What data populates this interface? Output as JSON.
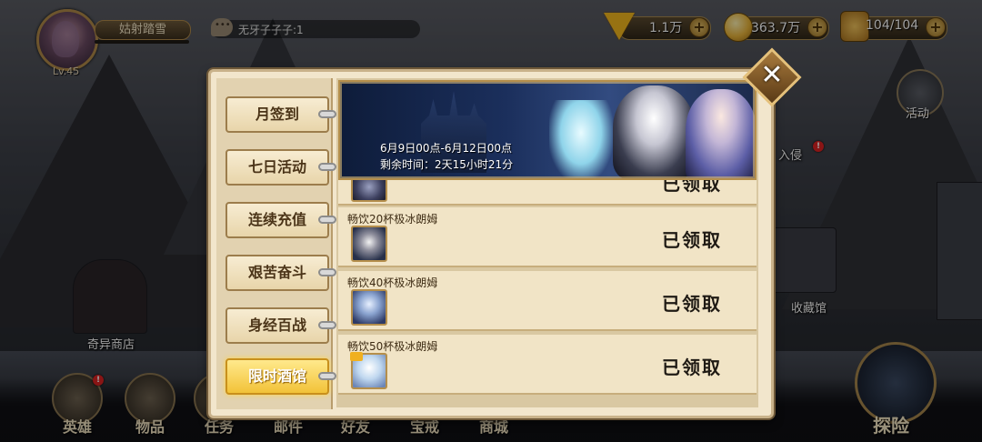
{
  "player": {
    "level": "Lv.45",
    "name": "姑射踏雪"
  },
  "chat": {
    "text": "无牙子子子:1"
  },
  "resources": [
    {
      "icon": "diamond-icon",
      "value": "1.1万"
    },
    {
      "icon": "gold-coin-icon",
      "value": "363.7万"
    },
    {
      "icon": "stamina-icon",
      "value": "104/104"
    }
  ],
  "side": {
    "activity_label": "活动",
    "invasion_label": "入侵",
    "collection_label": "收藏馆",
    "shop_label": "奇异商店"
  },
  "bottom_nav": [
    "英雄",
    "物品",
    "任务",
    "邮件",
    "好友",
    "宝戒",
    "商城"
  ],
  "explore_label": "探险",
  "panel": {
    "tabs": [
      "月签到",
      "七日活动",
      "连续充值",
      "艰苦奋斗",
      "身经百战",
      "限时酒馆"
    ],
    "active_tab": "限时酒馆",
    "banner": {
      "date_range": "6月9日00点-6月12日00点",
      "remaining": "剩余时间：2天15小时21分"
    },
    "rows": [
      {
        "title": "畅饮20杯极冰朗姆",
        "status": "已领取"
      },
      {
        "title": "畅饮40杯极冰朗姆",
        "status": "已领取"
      },
      {
        "title": "畅饮50杯极冰朗姆",
        "status": "已领取"
      }
    ],
    "partial_row_status": "已领取"
  },
  "colors": {
    "active_tab": "#f2c238",
    "panel_bg": "#f2e6cc",
    "frame": "#c9b28a"
  }
}
